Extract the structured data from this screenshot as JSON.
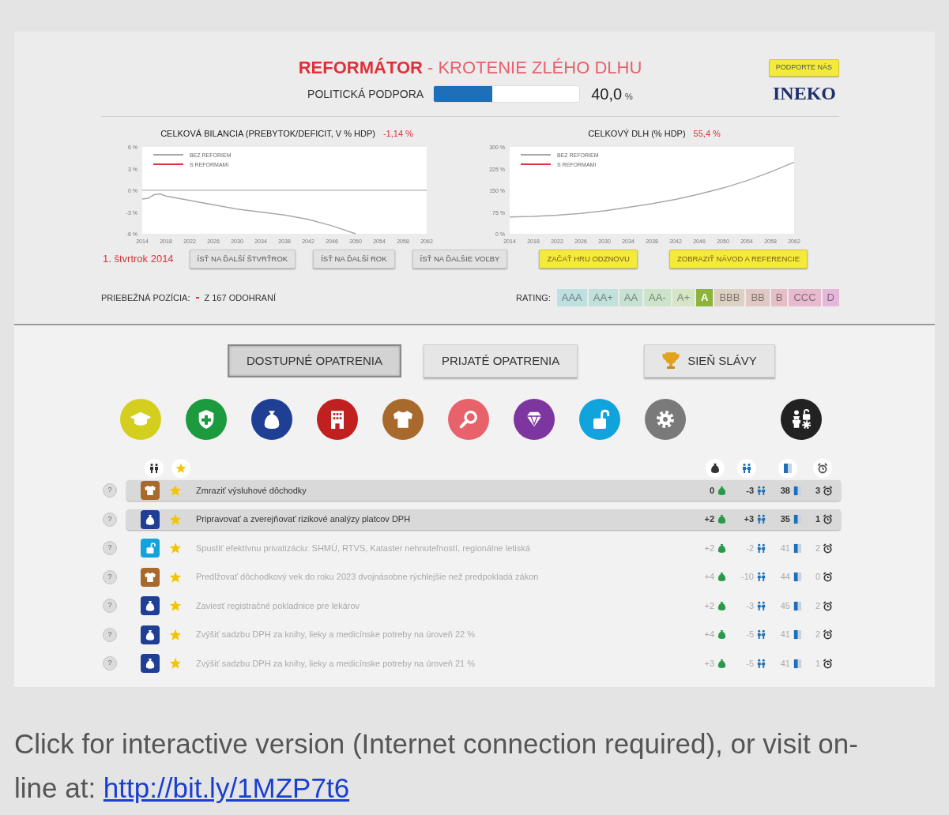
{
  "header": {
    "title": "REFORMÁTOR",
    "subtitle": "- KROTENIE ZLÉHO DLHU",
    "support_label": "POLITICKÁ PODPORA",
    "support": {
      "level": 0.4
    },
    "support_value": "40,0",
    "support_unit": "%",
    "donate_button": "PODPORTE NÁS",
    "logo": "INEKO"
  },
  "charts": [
    {
      "value": "-1,14 %",
      "legend": [
        {
          "label": "S REFORMAMI",
          "color": "#e0303a"
        }
      ],
      "chart_data": {
        "type": "line",
        "title": "CELKOVÁ BILANCIA (PREBYTOK/DEFICIT, V % HDP)",
        "x": [
          2014,
          2015,
          2016,
          2017,
          2018,
          2022,
          2026,
          2030,
          2034,
          2038,
          2042,
          2046,
          2050
        ],
        "series": [
          {
            "name": "BEZ REFORIEM",
            "color": "#a8a8a8",
            "values": [
              -1.2,
              -1.1,
              -0.6,
              -0.5,
              -0.8,
              -1.4,
              -2.0,
              -2.6,
              -3.0,
              -3.4,
              -4.0,
              -4.9,
              -6.0
            ]
          }
        ],
        "xlim": [
          2014,
          2062
        ],
        "ylim": [
          -6,
          6
        ],
        "xticks": [
          2014,
          2018,
          2022,
          2026,
          2030,
          2034,
          2038,
          2042,
          2046,
          2050,
          2054,
          2058,
          2062
        ],
        "yticks": [
          {
            "value": -6,
            "label": "-6 %"
          },
          {
            "value": -3,
            "label": "-3 %"
          },
          {
            "value": 0,
            "label": "0 %"
          },
          {
            "value": 3,
            "label": "3 %"
          },
          {
            "value": 6,
            "label": "6 %"
          }
        ]
      }
    },
    {
      "value": "55,4 %",
      "legend": [
        {
          "label": "S REFORMAMI",
          "color": "#e0303a"
        }
      ],
      "chart_data": {
        "type": "line",
        "title": "CELKOVÝ DLH (% HDP)",
        "x": [
          2014,
          2018,
          2022,
          2026,
          2030,
          2034,
          2038,
          2042,
          2046,
          2050,
          2054,
          2058,
          2062
        ],
        "series": [
          {
            "name": "BEZ REFORIEM",
            "color": "#a8a8a8",
            "values": [
              58,
              60,
              64,
              70,
              79,
              91,
              104,
              119,
              137,
              158,
              183,
              213,
              247
            ]
          }
        ],
        "xlim": [
          2014,
          2062
        ],
        "ylim": [
          0,
          300
        ],
        "xticks": [
          2014,
          2018,
          2022,
          2026,
          2030,
          2034,
          2038,
          2042,
          2046,
          2050,
          2054,
          2058,
          2062
        ],
        "yticks": [
          {
            "value": 0,
            "label": "0 %"
          },
          {
            "value": 75,
            "label": "75 %"
          },
          {
            "value": 150,
            "label": "150 %"
          },
          {
            "value": 225,
            "label": "225 %"
          },
          {
            "value": 300,
            "label": "300 %"
          }
        ]
      }
    }
  ],
  "quarter": "1. štvrtrok 2014",
  "controls": [
    {
      "label": "ÍSŤ NA ĎALŠÍ ŠTVRŤROK",
      "kind": "gray"
    },
    {
      "label": "ÍSŤ NA ĎALŠÍ ROK",
      "kind": "gray"
    },
    {
      "label": "ÍSŤ NA ĎALŠIE VOĽBY",
      "kind": "gray"
    },
    {
      "label": "ZAČAŤ HRU ODZNOVU",
      "kind": "yellow"
    },
    {
      "label": "ZOBRAZIŤ NÁVOD A REFERENCIE",
      "kind": "yellow"
    }
  ],
  "position_label": "PRIEBEŽNÁ POZÍCIA:",
  "position_value": "Z 167 ODOHRANÍ",
  "rating_label": "RATING:",
  "ratings": [
    {
      "label": "AAA",
      "color": "#bfe0e0",
      "selected": false
    },
    {
      "label": "AA+",
      "color": "#c2e1da",
      "selected": false
    },
    {
      "label": "AA",
      "color": "#c7e2d2",
      "selected": false
    },
    {
      "label": "AA-",
      "color": "#cde4cb",
      "selected": false
    },
    {
      "label": "A+",
      "color": "#d5e5c5",
      "selected": false
    },
    {
      "label": "A",
      "color": "#8db33a",
      "selected": true
    },
    {
      "label": "BBB",
      "color": "#ddd1c4",
      "selected": false
    },
    {
      "label": "BB",
      "color": "#e2c8c5",
      "selected": false
    },
    {
      "label": "B",
      "color": "#e6bec6",
      "selected": false
    },
    {
      "label": "CCC",
      "color": "#e8bad0",
      "selected": false
    },
    {
      "label": "D",
      "color": "#e5b8da",
      "selected": false
    }
  ],
  "tabs": [
    {
      "label": "DOSTUPNÉ OPATRENIA",
      "selected": true,
      "kind": "plain"
    },
    {
      "label": "PRIJATÉ OPATRENIA",
      "selected": false,
      "kind": "plain"
    },
    {
      "label": "SIEŇ SLÁVY",
      "selected": false,
      "kind": "trophy"
    }
  ],
  "categories": [
    {
      "kind": "cap",
      "color": "#d4cf1f"
    },
    {
      "kind": "shield",
      "color": "#1b9a3e"
    },
    {
      "kind": "bag",
      "color": "#1f3f94"
    },
    {
      "kind": "building",
      "color": "#c0201f"
    },
    {
      "kind": "shirt",
      "color": "#a8692c"
    },
    {
      "kind": "search",
      "color": "#e8626b"
    },
    {
      "kind": "diamond",
      "color": "#7d35a0"
    },
    {
      "kind": "lock",
      "color": "#11a3dc"
    },
    {
      "kind": "gear",
      "color": "#7a7a7a"
    },
    {
      "kind": "all",
      "color": "#222222"
    }
  ],
  "measures": [
    {
      "help": "?",
      "kind": "shirt",
      "color": "#a8692c",
      "title": "Zmraziť výsluhové dôchodky",
      "highlighted": true,
      "money": "0",
      "people": "-3",
      "rating": "38",
      "time": "3"
    },
    {
      "help": "?",
      "kind": "bag",
      "color": "#1f3f94",
      "title": "Pripravovať a zverejňovať rizikové analýzy platcov DPH",
      "highlighted": true,
      "money": "+2",
      "people": "+3",
      "rating": "35",
      "time": "1"
    },
    {
      "help": "?",
      "kind": "lock",
      "color": "#11a3dc",
      "title": "Spustiť efektívnu privatizáciu: SHMÚ, RTVS, Kataster nehnuteľností, regionálne letiská",
      "highlighted": false,
      "money": "+2",
      "people": "-2",
      "rating": "41",
      "time": "2"
    },
    {
      "help": "?",
      "kind": "shirt",
      "color": "#a8692c",
      "title": "Predlžovať dôchodkový vek do roku 2023 dvojnásobne rýchlejšie než predpokladá zákon",
      "highlighted": false,
      "money": "+4",
      "people": "-10",
      "rating": "44",
      "time": "0"
    },
    {
      "help": "?",
      "kind": "bag",
      "color": "#1f3f94",
      "title": "Zaviesť registračné pokladnice pre lekárov",
      "highlighted": false,
      "money": "+2",
      "people": "-3",
      "rating": "45",
      "time": "2"
    },
    {
      "help": "?",
      "kind": "bag",
      "color": "#1f3f94",
      "title": "Zvýšiť sadzbu DPH za knihy, lieky a medicínske potreby na úroveň 22 %",
      "highlighted": false,
      "money": "+4",
      "people": "-5",
      "rating": "41",
      "time": "2"
    },
    {
      "help": "?",
      "kind": "bag",
      "color": "#1f3f94",
      "title": "Zvýšiť sadzbu DPH za knihy, lieky a medicínske potreby na úroveň 21 %",
      "highlighted": false,
      "money": "+3",
      "people": "-5",
      "rating": "41",
      "time": "1"
    }
  ],
  "footer": {
    "text": "Click for interactive version (Internet connection required), or visit on-line at:",
    "link": "http://bit.ly/1MZP7t6"
  }
}
